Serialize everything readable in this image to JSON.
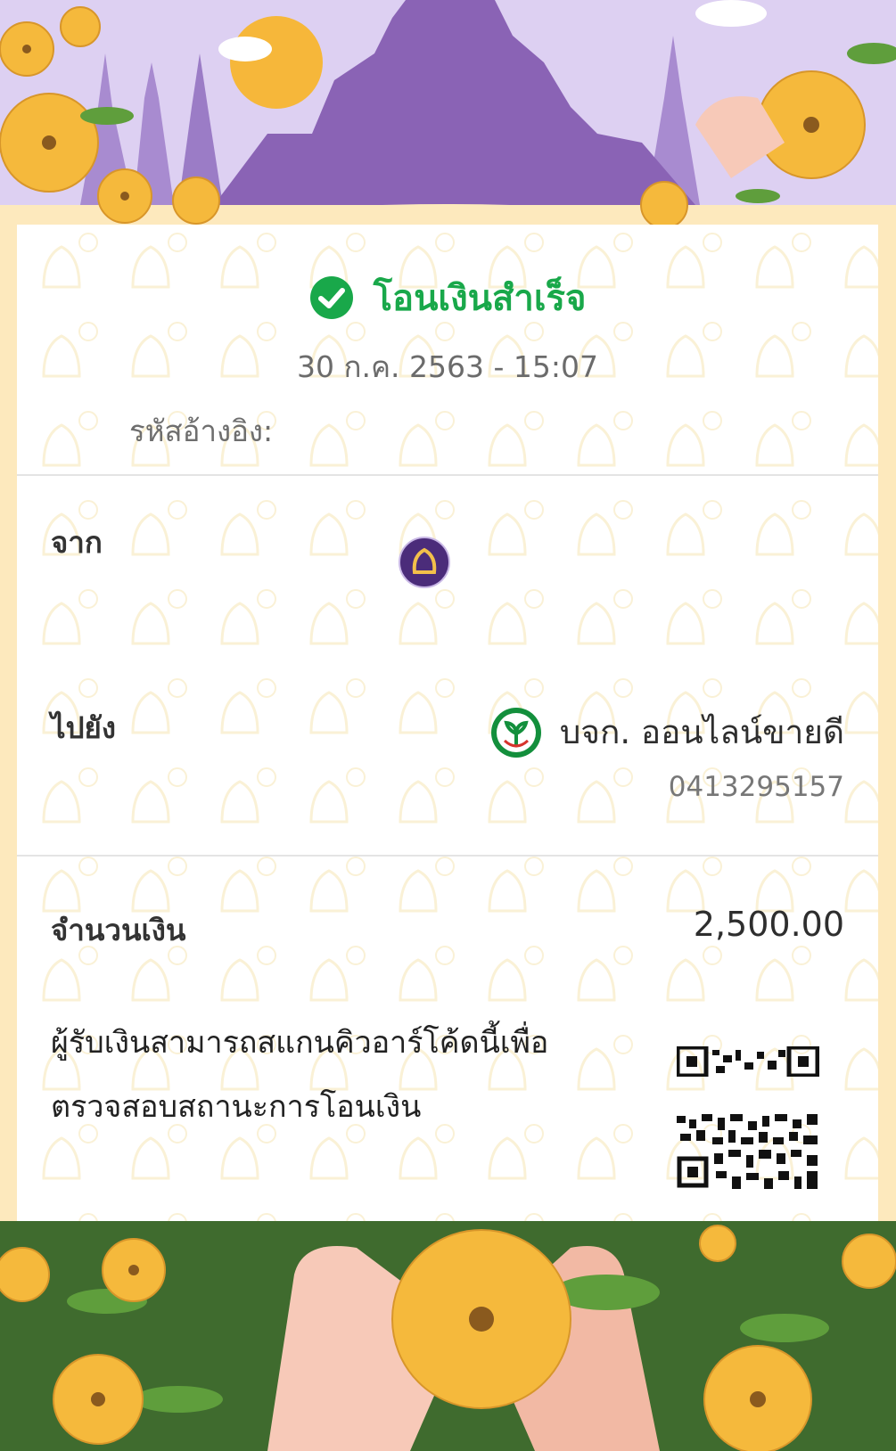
{
  "receipt": {
    "status_text": "โอนเงินสำเร็จ",
    "datetime": "30 ก.ค. 2563 - 15:07",
    "reference_label": "รหัสอ้างอิง:",
    "from_label": "จาก",
    "to_label": "ไปยัง",
    "to_name": "บจก. ออนไลน์ขายดี",
    "to_account": "0413295157",
    "amount_label": "จำนวนเงิน",
    "amount_value": "2,500.00",
    "qr_text": "ผู้รับเงินสามารถสแกนคิวอาร์โค้ดนี้เพื่อ ตรวจสอบสถานะการโอนเงิน"
  },
  "colors": {
    "success_green": "#19a84a",
    "header_purple": "#8a63b5",
    "sky_lavender": "#ddd0f2",
    "footer_green": "#3f6b2e",
    "flower_yellow": "#f5b93c",
    "page_cream": "#fde9bd",
    "sender_bank_purple": "#4b2c7a",
    "receiver_bank_green": "#138f3c"
  },
  "icons": {
    "status": "check-circle-icon",
    "sender_bank": "sender-bank-logo-icon",
    "receiver_bank": "receiver-bank-logo-icon",
    "qr": "qr-code-icon"
  }
}
